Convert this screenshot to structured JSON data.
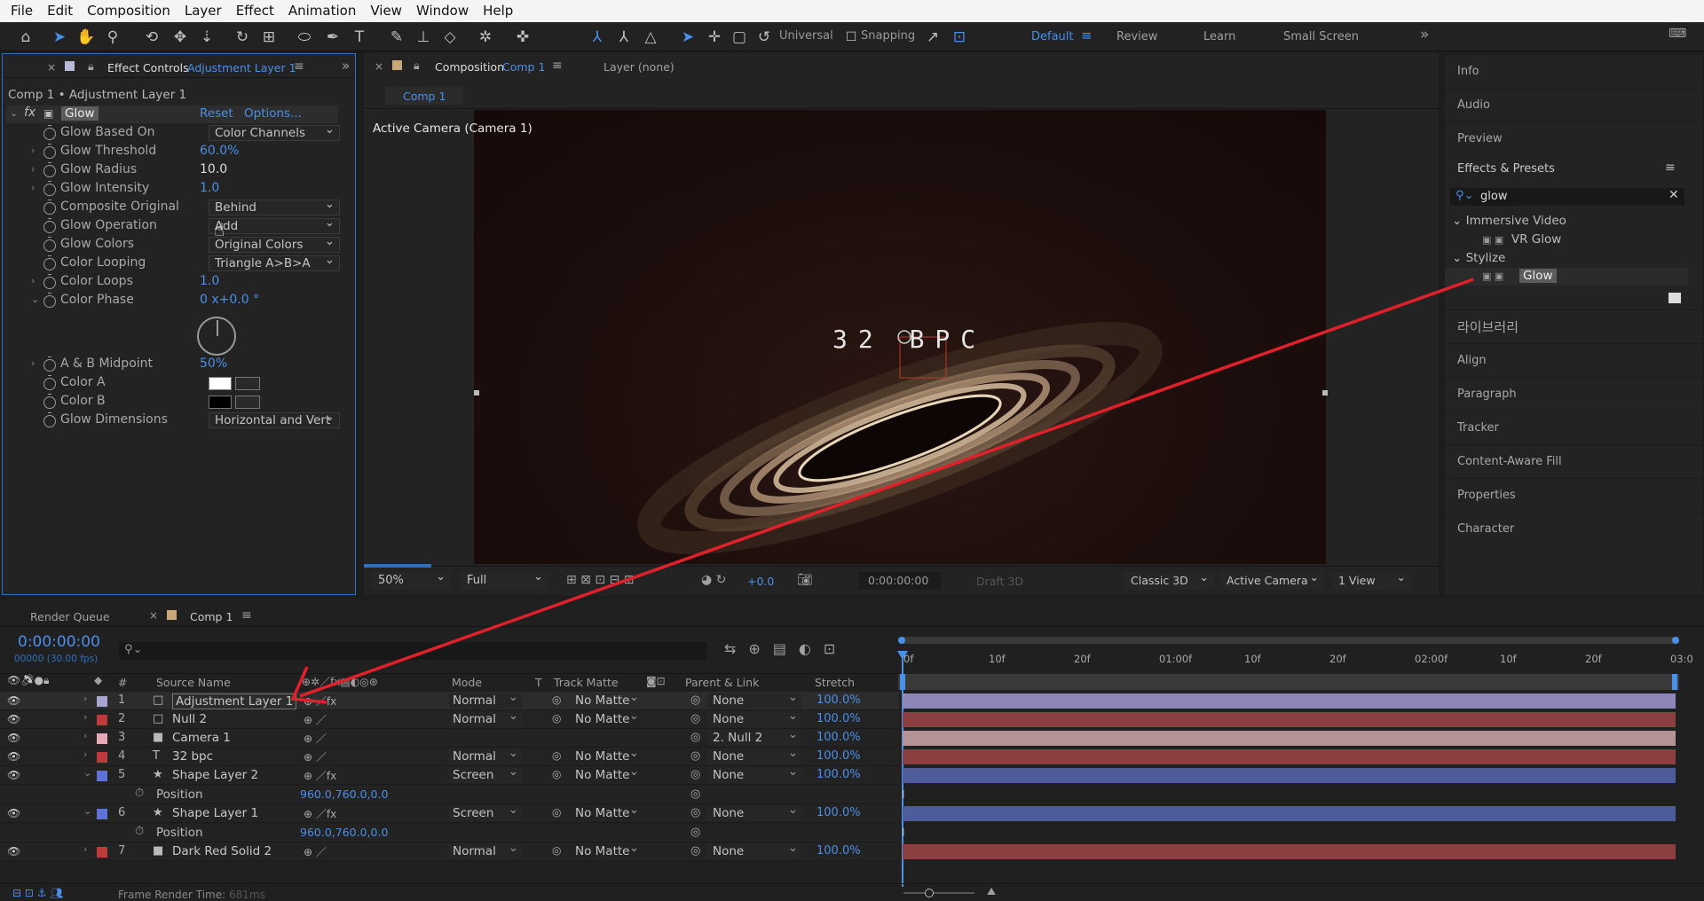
{
  "menu": [
    "File",
    "Edit",
    "Composition",
    "Layer",
    "Effect",
    "Animation",
    "View",
    "Window",
    "Help"
  ],
  "toolbar": {
    "universal": "Universal",
    "snapping": "Snapping"
  },
  "workspaces": [
    "Default",
    "Review",
    "Learn",
    "Small Screen"
  ],
  "effect_controls": {
    "tab_label": "Effect Controls",
    "tab_layer": "Adjustment Layer 1",
    "breadcrumb": "Comp 1 • Adjustment Layer 1",
    "effect_name": "Glow",
    "reset": "Reset",
    "options": "Options...",
    "props": [
      {
        "name": "Glow Based On",
        "type": "select",
        "value": "Color Channels"
      },
      {
        "name": "Glow Threshold",
        "type": "value",
        "value": "60.0%"
      },
      {
        "name": "Glow Radius",
        "type": "value",
        "value": "10.0"
      },
      {
        "name": "Glow Intensity",
        "type": "value",
        "value": "1.0"
      },
      {
        "name": "Composite Original",
        "type": "select",
        "value": "Behind"
      },
      {
        "name": "Glow Operation",
        "type": "select",
        "value": "Add"
      },
      {
        "name": "Glow Colors",
        "type": "select",
        "value": "Original Colors"
      },
      {
        "name": "Color Looping",
        "type": "select",
        "value": "Triangle A>B>A"
      },
      {
        "name": "Color Loops",
        "type": "value",
        "value": "1.0"
      },
      {
        "name": "Color Phase",
        "type": "value",
        "value": "0 x+0.0 °"
      },
      {
        "name": "A & B Midpoint",
        "type": "value",
        "value": "50%"
      },
      {
        "name": "Color A",
        "type": "color",
        "value": "#ffffff"
      },
      {
        "name": "Color B",
        "type": "color",
        "value": "#000000"
      },
      {
        "name": "Glow Dimensions",
        "type": "select",
        "value": "Horizontal and Vert"
      }
    ]
  },
  "composition": {
    "tab_label": "Composition",
    "tab_comp": "Comp 1",
    "layer_tab": "Layer (none)",
    "subtab": "Comp 1",
    "camera_label": "Active Camera (Camera 1)",
    "viewer_text": "32 BPC",
    "footer": {
      "zoom": "50%",
      "resolution": "Full",
      "exposure": "+0.0",
      "timecode": "0:00:00:00",
      "draft": "Draft 3D",
      "renderer": "Classic 3D",
      "camera": "Active Camera ...",
      "views": "1 View"
    }
  },
  "right_panel": {
    "items_top": [
      "Info",
      "Audio",
      "Preview"
    ],
    "effects_title": "Effects & Presets",
    "search_value": "glow",
    "tree": [
      {
        "group": "Immersive Video",
        "item": "VR Glow"
      },
      {
        "group": "Stylize",
        "item": "Glow"
      }
    ],
    "items_bottom": [
      "라이브러리",
      "Align",
      "Paragraph",
      "Tracker",
      "Content-Aware Fill",
      "Properties",
      "Character"
    ]
  },
  "timeline": {
    "render_queue": "Render Queue",
    "comp_tab": "Comp 1",
    "timecode": "0:00:00:00",
    "frames": "00000 (30.00 fps)",
    "headers": {
      "source": "Source Name",
      "mode": "Mode",
      "t": "T",
      "track_matte": "Track Matte",
      "parent": "Parent & Link",
      "stretch": "Stretch"
    },
    "ruler": [
      "0f",
      "10f",
      "20f",
      "01:00f",
      "10f",
      "20f",
      "02:00f",
      "10f",
      "20f",
      "03:0"
    ],
    "layers": [
      {
        "num": "1",
        "name": "Adjustment Layer 1",
        "icon": "□",
        "color": "#a9a5d4",
        "mode": "Normal",
        "matte": "No Matte",
        "parent": "None",
        "stretch": "100.0%",
        "bar": "#8e86b8"
      },
      {
        "num": "2",
        "name": "Null 2",
        "icon": "□",
        "color": "#c0393b",
        "mode": "Normal",
        "matte": "No Matte",
        "parent": "None",
        "stretch": "100.0%",
        "bar": "#8c3f40"
      },
      {
        "num": "3",
        "name": "Camera 1",
        "icon": "■",
        "color": "#e6a9b5",
        "mode": "",
        "matte": "",
        "parent": "2. Null 2",
        "stretch": "100.0%",
        "bar": "#b49397"
      },
      {
        "num": "4",
        "name": "32 bpc",
        "icon": "T",
        "color": "#c0393b",
        "mode": "Normal",
        "matte": "No Matte",
        "parent": "None",
        "stretch": "100.0%",
        "bar": "#8c3f40"
      },
      {
        "num": "5",
        "name": "Shape Layer 2",
        "icon": "★",
        "color": "#5e72d9",
        "mode": "Screen",
        "matte": "No Matte",
        "parent": "None",
        "stretch": "100.0%",
        "bar": "#4e5c9c"
      },
      {
        "prop": "Position",
        "value": "960.0,760.0,0.0"
      },
      {
        "num": "6",
        "name": "Shape Layer 1",
        "icon": "★",
        "color": "#5e72d9",
        "mode": "Screen",
        "matte": "No Matte",
        "parent": "None",
        "stretch": "100.0%",
        "bar": "#4e5c9c"
      },
      {
        "prop": "Position",
        "value": "960.0,760.0,0.0"
      },
      {
        "num": "7",
        "name": "Dark Red Solid 2",
        "icon": "■",
        "color": "#c0393b",
        "mode": "Normal",
        "matte": "No Matte",
        "parent": "None",
        "stretch": "100.0%",
        "bar": "#8c3f40"
      }
    ],
    "footer_label": "Frame Render Time:",
    "footer_value": "681ms"
  },
  "colors": {
    "accent": "#4a8fe8",
    "arrow": "#e0202a"
  }
}
